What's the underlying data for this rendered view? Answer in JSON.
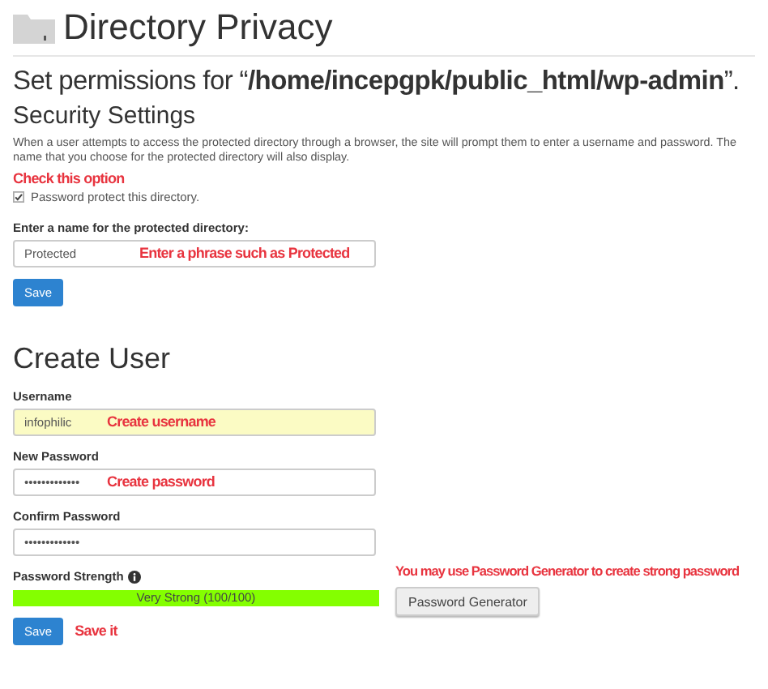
{
  "page_title": "Directory Privacy",
  "permissions_heading": "Set permissions for “**/home/incepgpk/public_html/wp-admin**”.",
  "security": {
    "heading": "Security Settings",
    "description": "When a user attempts to access the protected directory through a browser, the site will prompt them to enter a username and password. The name that you choose for the protected directory will also display.",
    "note": "Check this option",
    "checkbox": {
      "label": "Password protect this directory.",
      "checked": true
    },
    "name_field": {
      "label": "Enter a name for the protected directory:",
      "value": "Protected",
      "note": "Enter a phrase such as Protected"
    },
    "save": "Save"
  },
  "create_user": {
    "heading": "Create User",
    "fields": [
      {
        "label": "Username",
        "value": "infophilic",
        "note": "Create username",
        "highlighted": true
      },
      {
        "label": "New Password",
        "value": "•••••••••••••",
        "note": "Create password",
        "highlighted": false
      },
      {
        "label": "Confirm Password",
        "value": "•••••••••••••",
        "highlighted": false
      }
    ],
    "strength": {
      "label": "Password Strength",
      "level": 1,
      "reading": "Very Strong (100/100)"
    },
    "generator_note": "You may use Password Generator to create strong password",
    "generator_button": "Password Generator",
    "save": "Save",
    "save_note": "Save it"
  }
}
